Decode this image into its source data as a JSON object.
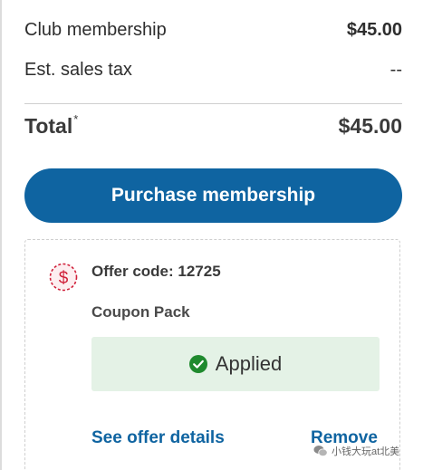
{
  "summary": {
    "club_membership_label": "Club membership",
    "club_membership_value": "$45.00",
    "sales_tax_label": "Est. sales tax",
    "sales_tax_value": "--",
    "total_label": "Total",
    "total_marker": "*",
    "total_value": "$45.00"
  },
  "purchase": {
    "button_label": "Purchase membership",
    "button_color": "#0f64a1"
  },
  "offer": {
    "icon": "dollar-coupon-icon",
    "icon_color": "#d0203a",
    "code_text": "Offer code: 12725",
    "name": "Coupon Pack",
    "status_icon": "check-circle-icon",
    "status_text": "Applied",
    "status_color": "#1f8a2e",
    "see_details_label": "See offer details",
    "remove_label": "Remove"
  },
  "watermark": {
    "icon": "wechat-icon",
    "text": "小钱大玩at北美"
  }
}
